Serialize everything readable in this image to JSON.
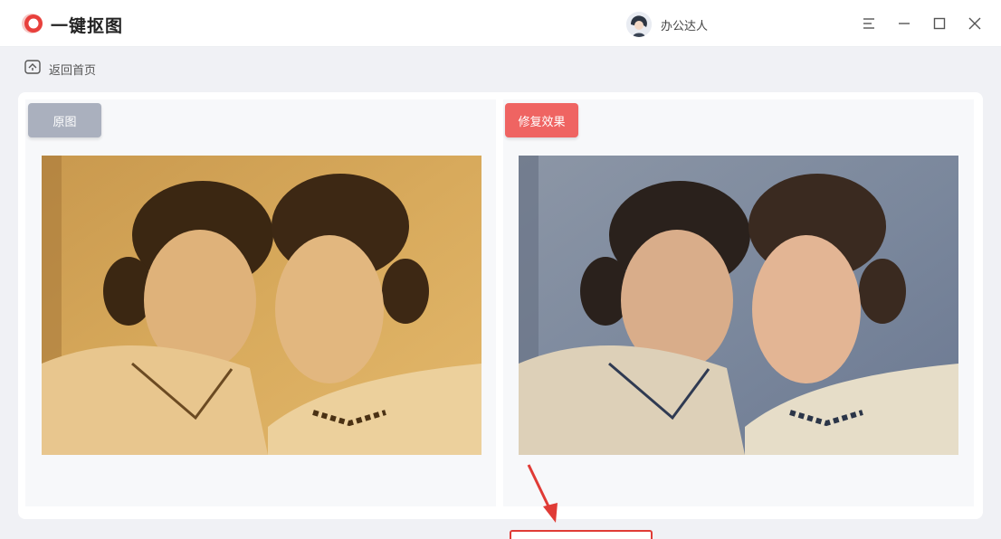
{
  "app": {
    "title": "一键抠图",
    "brand_color": "#e8403c"
  },
  "user": {
    "name": "办公达人",
    "avatar_icon": "avatar-icon"
  },
  "window_controls": {
    "menu_icon": "menu-icon",
    "minimize_icon": "minimize-icon",
    "maximize_icon": "maximize-icon",
    "close_icon": "close-icon"
  },
  "nav": {
    "back_label": "返回首页",
    "back_icon": "home-icon"
  },
  "compare": {
    "original_label": "原图",
    "restored_label": "修复效果",
    "original_tag_color": "#aab0be",
    "restored_tag_color": "#ef6462"
  },
  "annotations": {
    "arrow_color": "#e03b36"
  }
}
